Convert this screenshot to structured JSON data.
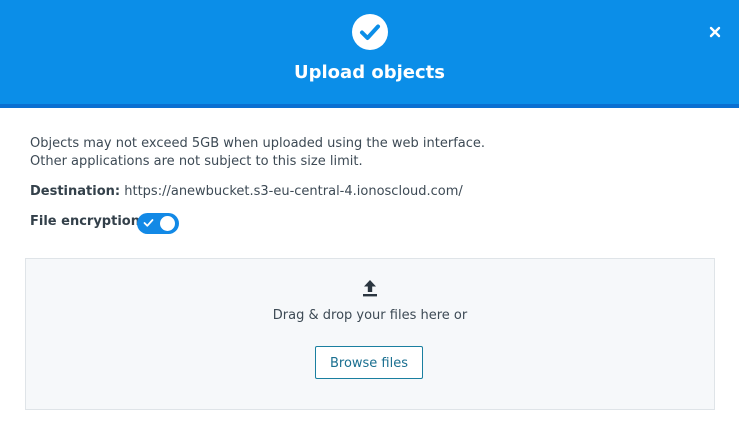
{
  "dialog": {
    "title": "Upload objects",
    "close_icon": "close-icon",
    "header_icon": "check-circle-icon",
    "header_color": "#0b8ee8"
  },
  "info": {
    "line1": "Objects may not exceed 5GB when uploaded using the web interface.",
    "line2": "Other applications are not subject to this size limit."
  },
  "destination": {
    "label": "Destination:",
    "value": "https://anewbucket.s3-eu-central-4.ionoscloud.com/"
  },
  "encryption": {
    "label": "File encryption:",
    "enabled": true
  },
  "dropzone": {
    "icon": "upload-icon",
    "text": "Drag & drop your files here or",
    "browse_label": "Browse files"
  }
}
